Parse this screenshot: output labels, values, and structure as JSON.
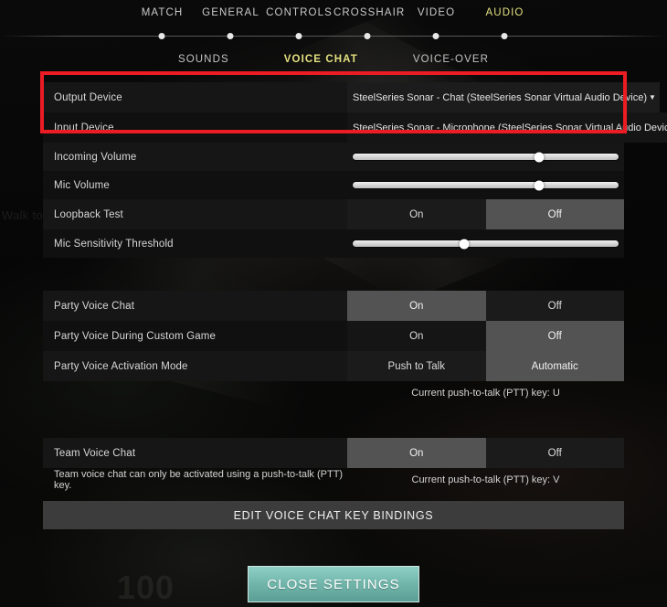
{
  "nav": {
    "main_tabs": [
      {
        "label": "MATCH",
        "active": false
      },
      {
        "label": "GENERAL",
        "active": false
      },
      {
        "label": "CONTROLS",
        "active": false
      },
      {
        "label": "CROSSHAIR",
        "active": false
      },
      {
        "label": "VIDEO",
        "active": false
      },
      {
        "label": "AUDIO",
        "active": true
      }
    ],
    "sub_tabs": [
      {
        "label": "SOUNDS",
        "active": false
      },
      {
        "label": "VOICE CHAT",
        "active": true
      },
      {
        "label": "VOICE-OVER",
        "active": false
      }
    ]
  },
  "background": {
    "hint_text": "Walk to the",
    "health_value": "100"
  },
  "devices": {
    "output_label": "Output Device",
    "output_value": "SteelSeries Sonar - Chat (SteelSeries Sonar Virtual Audio Device)",
    "input_label": "Input Device",
    "input_value": "SteelSeries Sonar - Microphone (SteelSeries Sonar Virtual Audio Device)",
    "caret": "▼"
  },
  "audio": {
    "incoming_volume_label": "Incoming Volume",
    "incoming_volume_percent": 70,
    "mic_volume_label": "Mic Volume",
    "mic_volume_percent": 70,
    "loopback_label": "Loopback Test",
    "loopback_on": "On",
    "loopback_off": "Off",
    "loopback_selected": "Off",
    "mic_sensitivity_label": "Mic Sensitivity Threshold",
    "mic_sensitivity_percent": 42
  },
  "party": {
    "voice_chat_label": "Party Voice Chat",
    "voice_chat_on": "On",
    "voice_chat_off": "Off",
    "voice_chat_selected": "On",
    "custom_game_label": "Party Voice During Custom Game",
    "custom_game_on": "On",
    "custom_game_off": "Off",
    "custom_game_selected": "Off",
    "activation_mode_label": "Party Voice Activation Mode",
    "activation_mode_ptt": "Push to Talk",
    "activation_mode_auto": "Automatic",
    "activation_mode_selected": "Automatic",
    "ptt_key_note": "Current push-to-talk (PTT) key: U"
  },
  "team": {
    "voice_chat_label": "Team Voice Chat",
    "voice_chat_on": "On",
    "voice_chat_off": "Off",
    "voice_chat_selected": "On",
    "helper_note": "Team voice chat can only be activated using a push-to-talk (PTT) key.",
    "ptt_key_note": "Current push-to-talk (PTT) key: V"
  },
  "actions": {
    "edit_bindings": "EDIT VOICE CHAT KEY BINDINGS",
    "close_settings": "CLOSE SETTINGS"
  },
  "colors": {
    "accent_gold": "#e3e07f",
    "annotation_red": "#ec1c24",
    "close_teal": "#73b7ac",
    "toggle_selected": "#535353"
  }
}
